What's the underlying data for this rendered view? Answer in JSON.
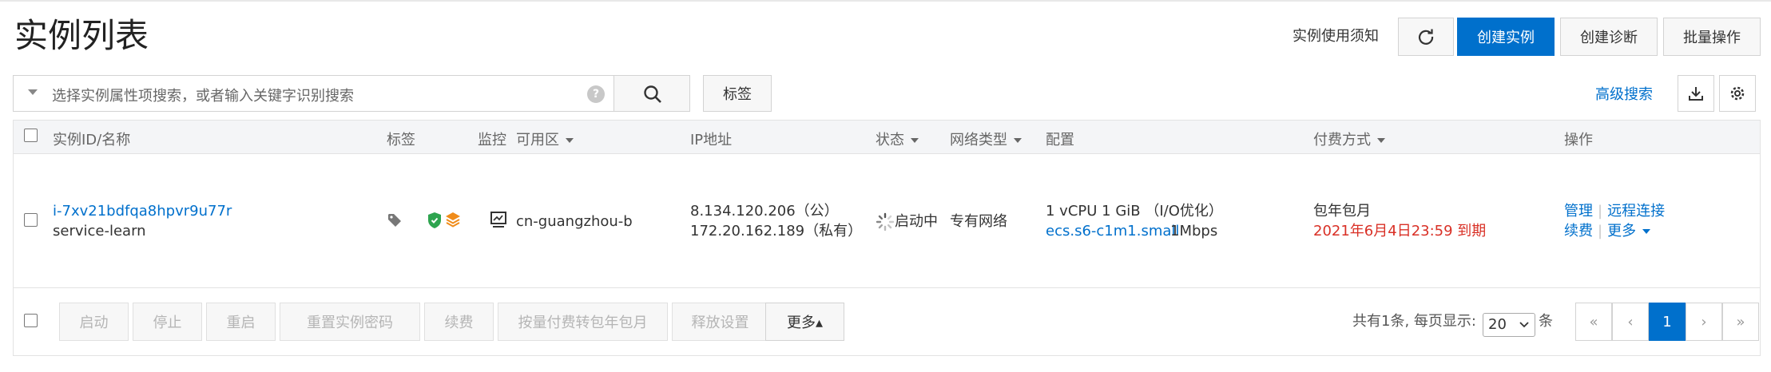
{
  "page": {
    "title": "实例列表"
  },
  "header": {
    "notice_link": "实例使用须知",
    "create_instance": "创建实例",
    "create_diagnosis": "创建诊断",
    "batch_ops": "批量操作"
  },
  "search": {
    "placeholder": "选择实例属性项搜索，或者输入关键字识别搜索",
    "help": "?",
    "tag_button": "标签",
    "advanced": "高级搜索"
  },
  "table": {
    "columns": {
      "id_name": "实例ID/名称",
      "tag": "标签",
      "monitor": "监控",
      "zone": "可用区",
      "ip": "IP地址",
      "status": "状态",
      "network": "网络类型",
      "config": "配置",
      "billing": "付费方式",
      "actions": "操作"
    },
    "rows": [
      {
        "instance_id": "i-7xv21bdfqa8hpvr9u77r",
        "name": "service-learn",
        "zone": "cn-guangzhou-b",
        "ip_public": "8.134.120.206（公）",
        "ip_private": "172.20.162.189（私有）",
        "status": "启动中",
        "network": "专有网络",
        "config_spec": "1 vCPU 1 GiB （I/O优化）",
        "config_type": "ecs.s6-c1m1.small",
        "bandwidth": "1Mbps",
        "billing": "包年包月",
        "expiry": "2021年6月4日23:59 到期",
        "actions": {
          "manage": "管理",
          "remote": "远程连接",
          "renew": "续费",
          "more": "更多"
        }
      }
    ]
  },
  "footer": {
    "buttons": [
      "启动",
      "停止",
      "重启",
      "重置实例密码",
      "续费",
      "按量付费转包年包月",
      "释放设置"
    ],
    "more": "更多▴",
    "summary": "共有1条, 每页显示:",
    "page_size": "20",
    "page_size_unit": "条",
    "pagination": {
      "first": "«",
      "prev": "‹",
      "current": "1",
      "next": "›",
      "last": "»"
    }
  },
  "colors": {
    "accent": "#0070cc",
    "danger": "#d93026",
    "status_green": "#2ea44f",
    "status_orange": "#f08c1a"
  }
}
